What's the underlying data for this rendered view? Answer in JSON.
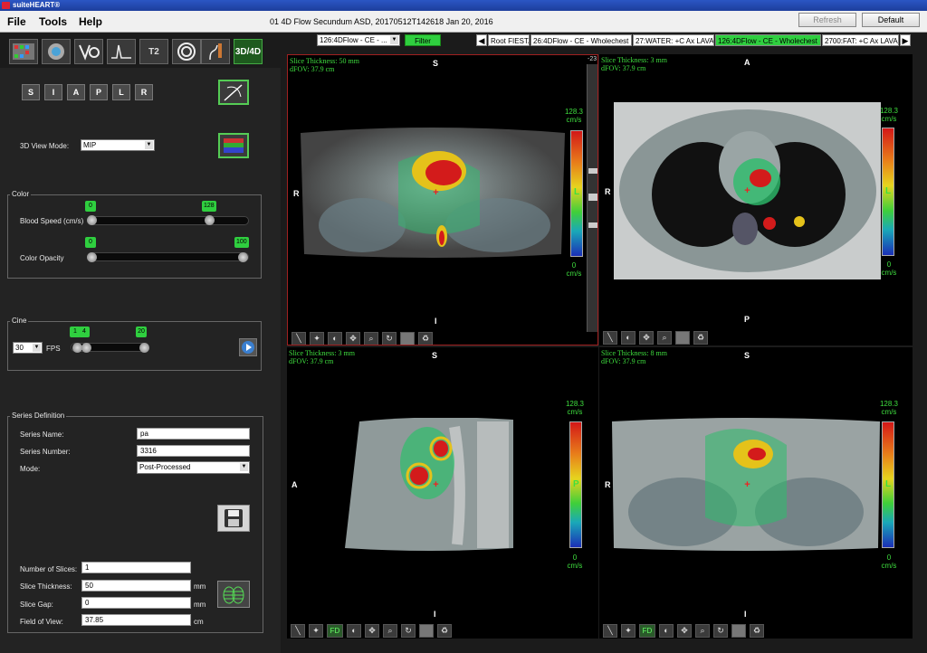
{
  "app_title": "suiteHEART®",
  "menu": {
    "file": "File",
    "tools": "Tools",
    "help": "Help"
  },
  "study_title": "01 4D Flow Secundum ASD, 20170512T142618   Jan 20, 2016",
  "top_buttons": {
    "refresh": "Refresh",
    "default": "Default"
  },
  "toolbar": {
    "t2_label": "T2",
    "view_3d4d": "3D/4D"
  },
  "series_select": "126:4DFlow - CE - ...",
  "filter_label": "Filter",
  "series_tabs": [
    {
      "label": "Root FIESTA",
      "active": false
    },
    {
      "label": "26:4DFlow - CE - Wholechest",
      "active": false
    },
    {
      "label": "27:WATER: +C Ax LAVA",
      "active": false
    },
    {
      "label": "126:4DFlow - CE - Wholechest",
      "active": true
    },
    {
      "label": "2700:FAT: +C Ax LAVA",
      "active": false
    }
  ],
  "orientation_buttons": [
    "S",
    "I",
    "A",
    "P",
    "L",
    "R"
  ],
  "view_mode": {
    "label": "3D View Mode:",
    "value": "MIP"
  },
  "color": {
    "title": "Color",
    "blood_speed_label": "Blood Speed (cm/s)",
    "blood_speed_min": "0",
    "blood_speed_max": "128",
    "opacity_label": "Color Opacity",
    "opacity_min": "0",
    "opacity_max": "100"
  },
  "cine": {
    "title": "Cine",
    "fps_value": "30",
    "fps_label": "FPS",
    "start": "1",
    "current": "4",
    "end": "20"
  },
  "series_definition": {
    "title": "Series Definition",
    "name_label": "Series Name:",
    "name_value": "pa",
    "number_label": "Series Number:",
    "number_value": "3316",
    "mode_label": "Mode:",
    "mode_value": "Post-Processed"
  },
  "slices": {
    "num_label": "Number of Slices:",
    "num_value": "1",
    "thickness_label": "Slice Thickness:",
    "thickness_value": "50",
    "thickness_unit": "mm",
    "gap_label": "Slice Gap:",
    "gap_value": "0",
    "gap_unit": "mm",
    "fov_label": "Field of View:",
    "fov_value": "37.85",
    "fov_unit": "cm"
  },
  "viewports": [
    {
      "id": "coronal",
      "info1": "Slice Thickness: 50 mm",
      "info2": "dFOV: 37.9 cm",
      "top": "S",
      "bottom": "I",
      "left": "R",
      "right": "L",
      "scale_max": "128.3",
      "scale_unit": "cm/s",
      "scale_min": "0",
      "scroll_value": "-23"
    },
    {
      "id": "axial",
      "info1": "Slice Thickness: 3 mm",
      "info2": "dFOV: 37.9 cm",
      "top": "A",
      "bottom": "P",
      "left": "R",
      "right": "L",
      "scale_max": "128.3",
      "scale_unit": "cm/s",
      "scale_min": "0"
    },
    {
      "id": "sagittal",
      "info1": "Slice Thickness: 3 mm",
      "info2": "dFOV: 37.9 cm",
      "top": "S",
      "bottom": "I",
      "left": "A",
      "right": "P",
      "scale_max": "128.3",
      "scale_unit": "cm/s",
      "scale_min": "0"
    },
    {
      "id": "coronal2",
      "info1": "Slice Thickness: 8 mm",
      "info2": "dFOV: 37.9 cm",
      "top": "S",
      "bottom": "I",
      "left": "R",
      "right": "L",
      "scale_max": "128.3",
      "scale_unit": "cm/s",
      "scale_min": "0"
    }
  ],
  "fd_label": "FD"
}
